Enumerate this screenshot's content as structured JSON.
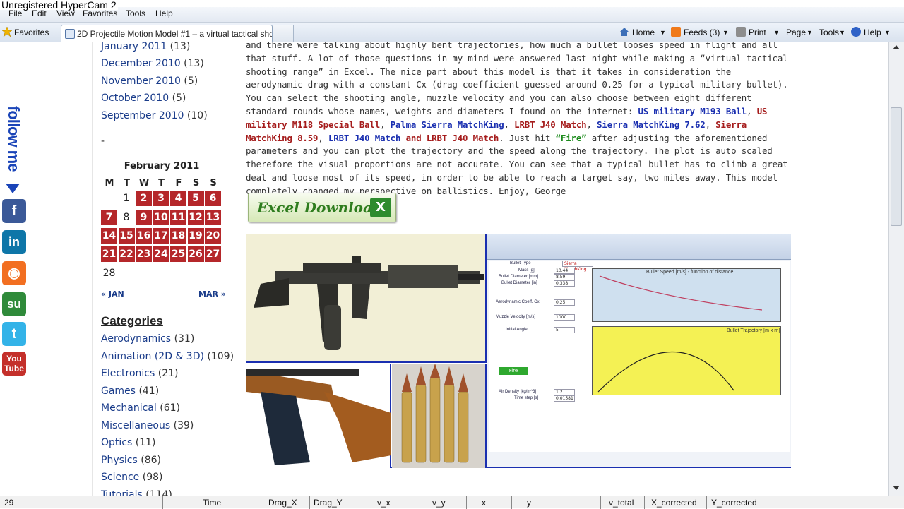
{
  "watermark": "Unregistered HyperCam 2",
  "menu": [
    "File",
    "Edit",
    "View",
    "Favorites",
    "Tools",
    "Help"
  ],
  "favbar": {
    "favorites_label": "Favorites",
    "tab_title": "2D Projectile Motion Model #1 – a virtual tactical shoo...",
    "home": "Home",
    "feeds": "Feeds (3)",
    "print": "Print",
    "page": "Page",
    "tools": "Tools",
    "help": "Help"
  },
  "social": {
    "follow_text": "follow me"
  },
  "archives": [
    {
      "month": "January 2011",
      "count": "(13)"
    },
    {
      "month": "December 2010",
      "count": "(13)"
    },
    {
      "month": "November 2010",
      "count": "(5)"
    },
    {
      "month": "October 2010",
      "count": "(5)"
    },
    {
      "month": "September 2010",
      "count": "(10)"
    }
  ],
  "dash": "-",
  "calendar": {
    "caption": "February 2011",
    "headers": [
      "M",
      "T",
      "W",
      "T",
      "F",
      "S",
      "S"
    ],
    "rows": [
      [
        "",
        "1",
        "2",
        "3",
        "4",
        "5",
        "6"
      ],
      [
        "7",
        "8",
        "9",
        "10",
        "11",
        "12",
        "13"
      ],
      [
        "14",
        "15",
        "16",
        "17",
        "18",
        "19",
        "20"
      ],
      [
        "21",
        "22",
        "23",
        "24",
        "25",
        "26",
        "27"
      ],
      [
        "28",
        "",
        "",
        "",
        "",
        "",
        ""
      ]
    ],
    "posted_days": [
      "2",
      "3",
      "4",
      "5",
      "6",
      "7",
      "9",
      "10",
      "11",
      "12",
      "13",
      "14",
      "15",
      "16",
      "17",
      "18",
      "19",
      "20",
      "21",
      "22",
      "23",
      "24",
      "25",
      "26",
      "27"
    ],
    "prev": "« JAN",
    "next": "MAR »"
  },
  "categories": {
    "heading": "Categories",
    "items": [
      {
        "name": "Aerodynamics",
        "count": "(31)"
      },
      {
        "name": "Animation (2D & 3D)",
        "count": "(109)"
      },
      {
        "name": "Electronics",
        "count": "(21)"
      },
      {
        "name": "Games",
        "count": "(41)"
      },
      {
        "name": "Mechanical",
        "count": "(61)"
      },
      {
        "name": "Miscellaneous",
        "count": "(39)"
      },
      {
        "name": "Optics",
        "count": "(11)"
      },
      {
        "name": "Physics",
        "count": "(86)"
      },
      {
        "name": "Science",
        "count": "(98)"
      },
      {
        "name": "Tutorials",
        "count": "(114)"
      }
    ]
  },
  "article": {
    "p1": "and there were talking about highly bent trajectories, how much a bullet looses speed in flight and all that stuff. A lot of those questions in my mind were answered last night while making a “virtual tactical shooting range” in Excel. The nice part about this model is that it takes in consideration the aerodynamic drag with a constant Cx (drag coefficient guessed around 0.25 for a typical military bullet). You can select the shooting angle, muzzle velocity and you can also choose between eight different standard rounds whose names, weights and diameters I found on the internet: ",
    "r1": "US military M193 Ball",
    "r2": "US military M118 Special Ball",
    "r3": "Palma Sierra MatchKing",
    "r4": "LRBT J40 Match",
    "r5": "Sierra MatchKing 7.62",
    "r6": "Sierra MatchKing 8.59",
    "r7": "LRBT J40 Match",
    "r8": "and LRBT J40 Match",
    "just_hit": ". Just hit ",
    "fire": "“Fire”",
    "p2": " after adjusting the aforementioned parameters and you can plot the trajectory and the speed along the trajectory. The plot is auto scaled therefore the visual proportions are not accurate. You can see that a typical bullet has to climb a great deal and loose most of its speed, in order to be able to reach a target say, two miles away. This model completely changed my perspective on ballistics. Enjoy, George",
    "download_label": "Excel Download"
  },
  "excel": {
    "bullet_type": "Bullet Type",
    "bullet_name": "Sierra MatchKing",
    "mass_label": "Mass [g]",
    "mass": "10.44",
    "diam_mm_label": "Bullet Diameter [mm]",
    "diam_mm": "8.59",
    "diam_in_label": "Bullet Diameter [in]",
    "diam_in": "0.338",
    "cx_label": "Aerodynamic Coeff. Cx",
    "cx": "0.25",
    "mv_label": "Muzzle Velocity [m/s]",
    "mv": "1000",
    "angle_label": "Initial Angle",
    "angle": "5",
    "fire": "Fire",
    "air_label": "Air Density [kg/m^3]",
    "air": "1.2",
    "dt_label": "Time step [s]",
    "dt": "0.01581",
    "chart1_title": "Bullet Speed [m/s] - function of distance",
    "chart2_title": "Bullet Trajectory [m x m]"
  },
  "statusbar": [
    "29",
    "Time",
    "Drag_X",
    "Drag_Y",
    "v_x",
    "v_y",
    "x",
    "y",
    "v_total",
    "X_corrected",
    "Y_corrected"
  ]
}
